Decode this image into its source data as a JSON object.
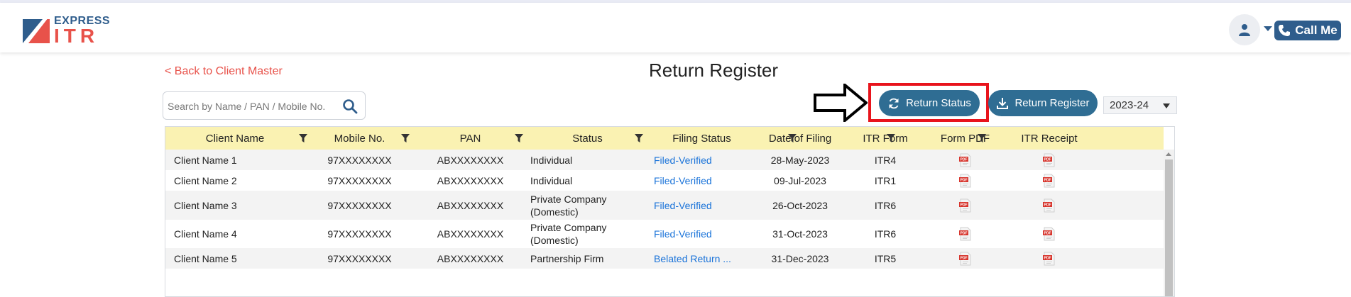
{
  "header": {
    "logo": {
      "express": "EXPRESS",
      "itr": "ITR"
    },
    "call_label": "Call Me"
  },
  "nav": {
    "back_label": "< Back to Client Master"
  },
  "page_title": "Return Register",
  "search": {
    "placeholder": "Search by Name / PAN / Mobile No."
  },
  "toolbar": {
    "return_status_label": "Return Status",
    "return_register_label": "Return Register",
    "year_value": "2023-24"
  },
  "colors": {
    "primary": "#2f6d93",
    "accent": "#e8524a",
    "header_row": "#faf2b2",
    "link": "#1a73d9",
    "highlight": "#e8141c"
  },
  "table": {
    "columns": [
      "Client Name",
      "Mobile No.",
      "PAN",
      "Status",
      "Filing Status",
      "Date of Filing",
      "ITR Form",
      "Form PDF",
      "ITR Receipt"
    ],
    "rows": [
      {
        "name": "Client Name 1",
        "mobile": "97XXXXXXXX",
        "pan": "ABXXXXXXXX",
        "status": "Individual",
        "filing": "Filed-Verified",
        "date": "28-May-2023",
        "form": "ITR4"
      },
      {
        "name": "Client Name 2",
        "mobile": "97XXXXXXXX",
        "pan": "ABXXXXXXXX",
        "status": "Individual",
        "filing": "Filed-Verified",
        "date": "09-Jul-2023",
        "form": "ITR1"
      },
      {
        "name": "Client Name 3",
        "mobile": "97XXXXXXXX",
        "pan": "ABXXXXXXXX",
        "status": "Private Company (Domestic)",
        "filing": "Filed-Verified",
        "date": "26-Oct-2023",
        "form": "ITR6"
      },
      {
        "name": "Client Name 4",
        "mobile": "97XXXXXXXX",
        "pan": "ABXXXXXXXX",
        "status": "Private Company (Domestic)",
        "filing": "Filed-Verified",
        "date": "31-Oct-2023",
        "form": "ITR6"
      },
      {
        "name": "Client Name 5",
        "mobile": "97XXXXXXXX",
        "pan": "ABXXXXXXXX",
        "status": "Partnership Firm",
        "filing": "Belated Return ...",
        "date": "31-Dec-2023",
        "form": "ITR5"
      }
    ]
  }
}
